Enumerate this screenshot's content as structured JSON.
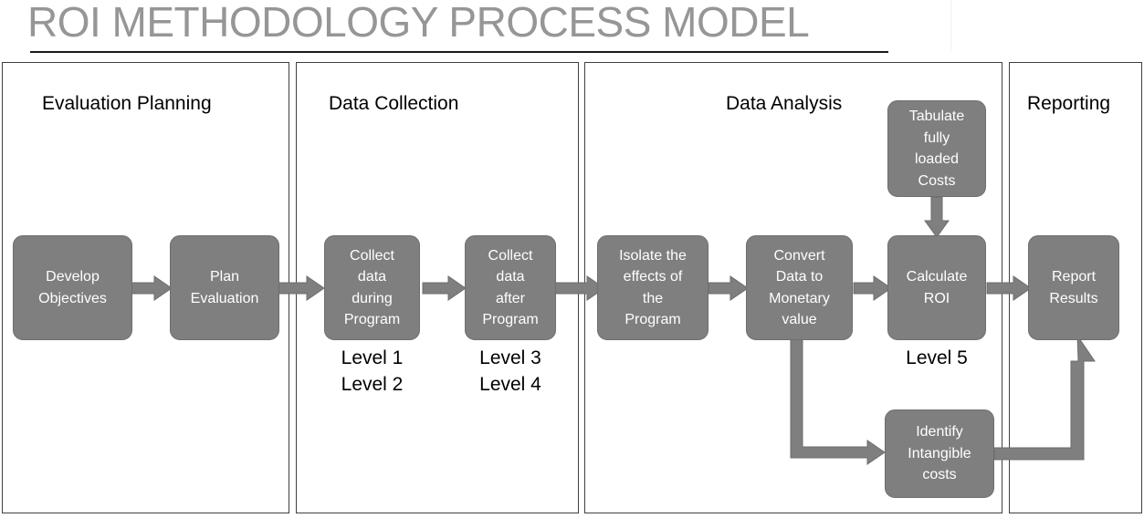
{
  "title": "ROI METHODOLOGY PROCESS MODEL",
  "colors": {
    "box_fill": "#7f7f7f",
    "box_border": "#6e6e6e",
    "box_text": "#ffffff",
    "panel_border": "#404040",
    "title_text": "#969696",
    "title_rule": "#1a1a1a",
    "arrow": "#7f7f7f",
    "background": "#ffffff"
  },
  "panels": [
    {
      "id": "evaluation-planning",
      "title": "Evaluation Planning"
    },
    {
      "id": "data-collection",
      "title": "Data Collection"
    },
    {
      "id": "data-analysis",
      "title": "Data Analysis"
    },
    {
      "id": "reporting",
      "title": "Reporting"
    }
  ],
  "boxes": [
    {
      "id": "develop-objectives",
      "lines": [
        "Develop",
        "Objectives"
      ]
    },
    {
      "id": "plan-evaluation",
      "lines": [
        "Plan",
        "Evaluation"
      ]
    },
    {
      "id": "collect-data-during",
      "lines": [
        "Collect",
        "data",
        "during",
        "Program"
      ]
    },
    {
      "id": "collect-data-after",
      "lines": [
        "Collect",
        "data",
        "after",
        "Program"
      ]
    },
    {
      "id": "isolate-effects",
      "lines": [
        "Isolate the",
        "effects of",
        "the",
        "Program"
      ]
    },
    {
      "id": "convert-data",
      "lines": [
        "Convert",
        "Data to",
        "Monetary",
        "value"
      ]
    },
    {
      "id": "tabulate-costs",
      "lines": [
        "Tabulate",
        "fully",
        "loaded",
        "Costs"
      ]
    },
    {
      "id": "calculate-roi",
      "lines": [
        "Calculate",
        "ROI"
      ]
    },
    {
      "id": "identify-intangible",
      "lines": [
        "Identify",
        "Intangible",
        "costs"
      ]
    },
    {
      "id": "report-results",
      "lines": [
        "Report",
        "Results"
      ]
    }
  ],
  "levels": [
    {
      "id": "levels-1-2",
      "lines": [
        "Level 1",
        "Level 2"
      ]
    },
    {
      "id": "levels-3-4",
      "lines": [
        "Level 3",
        "Level 4"
      ]
    },
    {
      "id": "level-5",
      "lines": [
        "Level 5"
      ]
    }
  ],
  "flow": {
    "sequence": [
      "Develop Objectives",
      "Plan Evaluation",
      "Collect data during Program",
      "Collect data after Program",
      "Isolate the effects of the Program",
      "Convert Data to Monetary value",
      "Calculate ROI",
      "Report Results"
    ],
    "branches": [
      "Tabulate fully loaded Costs -> Calculate ROI",
      "Convert Data to Monetary value -> Identify Intangible costs",
      "Identify Intangible costs -> Report Results"
    ]
  }
}
